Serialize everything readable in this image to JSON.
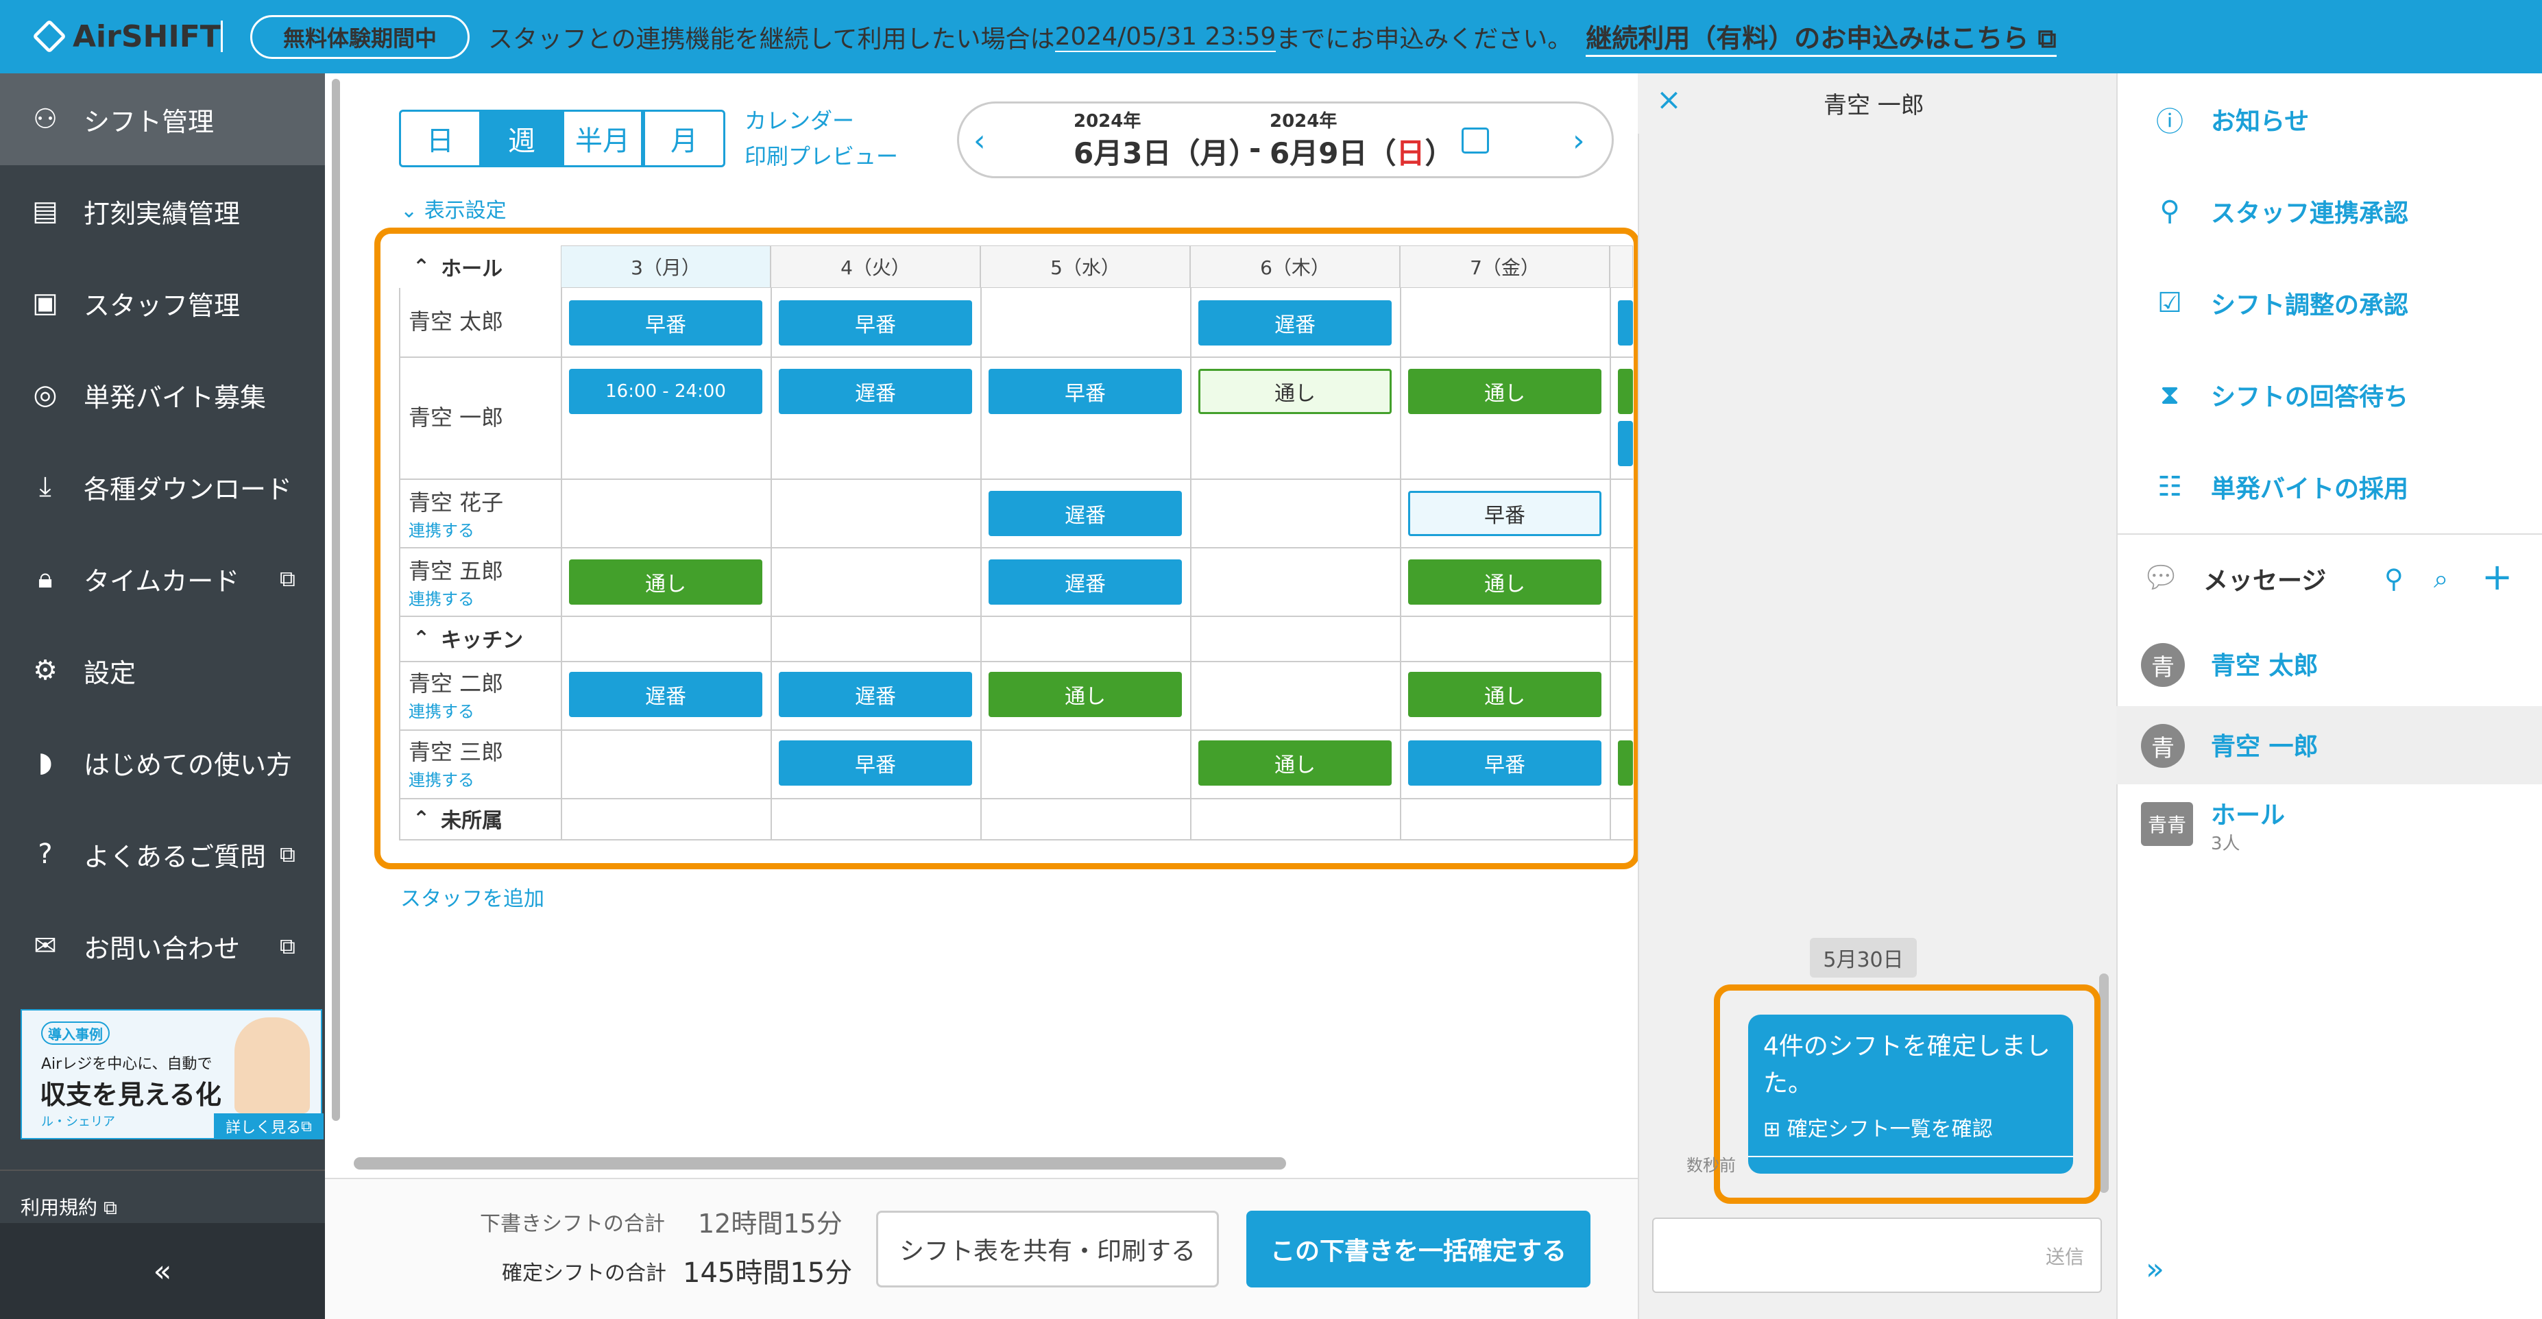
{
  "banner": {
    "logo": "AirSHIFT",
    "trial_badge": "無料体験期間中",
    "message_pre": "スタッフとの連携機能を継続して利用したい場合は",
    "deadline": "2024/05/31 23:59",
    "message_post": "までにお申込みください。",
    "link": "継続利用（有料）のお申込みはこちら"
  },
  "sidebar": {
    "items": [
      {
        "label": "シフト管理",
        "icon": "shift-icon"
      },
      {
        "label": "打刻実績管理",
        "icon": "timesheet-icon"
      },
      {
        "label": "スタッフ管理",
        "icon": "staff-card-icon"
      },
      {
        "label": "単発バイト募集",
        "icon": "recruit-icon"
      },
      {
        "label": "各種ダウンロード",
        "icon": "download-icon"
      },
      {
        "label": "タイムカード",
        "icon": "timecard-icon"
      },
      {
        "label": "設定",
        "icon": "gear-icon"
      },
      {
        "label": "はじめての使い方",
        "icon": "guide-icon"
      },
      {
        "label": "よくあるご質問",
        "icon": "question-icon"
      },
      {
        "label": "お問い合わせ",
        "icon": "mail-icon"
      }
    ],
    "promo": {
      "tag": "導入事例",
      "line1": "Airレジを中心に、自動で",
      "line2": "収支を見える化",
      "line3": "ル・シェリア",
      "button": "詳しく見る"
    },
    "terms": "利用規約",
    "collapse": "«"
  },
  "toolbar": {
    "views": [
      "日",
      "週",
      "半月",
      "月"
    ],
    "calendar_link": "カレンダー",
    "print_link": "印刷プレビュー",
    "start_year": "2024年",
    "start_date": "6月3日（月）",
    "end_year": "2024年",
    "end_date_pre": "6月9日（",
    "end_date_sun": "日",
    "end_date_post": "）",
    "dash": "-",
    "display_settings": "表示設定"
  },
  "table": {
    "days": [
      "3（月）",
      "4（火）",
      "5（水）",
      "6（木）",
      "7（金）"
    ],
    "groups": [
      "ホール",
      "キッチン",
      "未所属"
    ],
    "link_label": "連携する",
    "staff": [
      {
        "name": "青空 太郎",
        "link": false,
        "shifts": [
          "早番",
          "早番",
          "",
          "遅番",
          ""
        ]
      },
      {
        "name": "青空 一郎",
        "link": false,
        "shifts": [
          "16:00 - 24:00",
          "遅番",
          "早番",
          "通し",
          "通し"
        ]
      },
      {
        "name": "青空 花子",
        "link": true,
        "shifts": [
          "",
          "",
          "遅番",
          "",
          "早番"
        ]
      },
      {
        "name": "青空 五郎",
        "link": true,
        "shifts": [
          "通し",
          "",
          "遅番",
          "",
          "通し"
        ]
      },
      {
        "name": "青空 二郎",
        "link": true,
        "shifts": [
          "遅番",
          "遅番",
          "通し",
          "",
          "通し"
        ]
      },
      {
        "name": "青空 三郎",
        "link": true,
        "shifts": [
          "",
          "早番",
          "",
          "通し",
          "早番"
        ]
      }
    ],
    "add_staff": "スタッフを追加"
  },
  "footer": {
    "draft_label": "下書きシフトの合計",
    "draft_value": "12時間15分",
    "confirmed_label": "確定シフトの合計",
    "confirmed_value": "145時間15分",
    "share_button": "シフト表を共有・印刷する",
    "confirm_button": "この下書きを一括確定する"
  },
  "chat": {
    "close": "×",
    "title": "青空 一郎",
    "date": "5月30日",
    "message": "4件のシフトを確定しました。",
    "message_link": "確定シフト一覧を確認",
    "time": "数秒前",
    "send": "送信"
  },
  "right_panel": {
    "items": [
      {
        "label": "お知らせ",
        "icon": "info-icon"
      },
      {
        "label": "スタッフ連携承認",
        "icon": "person-add-icon"
      },
      {
        "label": "シフト調整の承認",
        "icon": "doc-check-icon"
      },
      {
        "label": "シフトの回答待ち",
        "icon": "doc-hourglass-icon"
      },
      {
        "label": "単発バイトの採用",
        "icon": "doc-person-icon"
      }
    ],
    "messages_title": "メッセージ",
    "contacts": [
      {
        "avatar": "青",
        "name": "青空 太郎",
        "sub": ""
      },
      {
        "avatar": "青",
        "name": "青空 一郎",
        "sub": ""
      },
      {
        "avatar": "青青",
        "name": "ホール",
        "sub": "3人"
      }
    ],
    "expand": "»"
  },
  "colors": {
    "accent": "#1ba0d8",
    "green": "#43a02b",
    "highlight": "#f39200",
    "sidebar": "#3a4248"
  }
}
